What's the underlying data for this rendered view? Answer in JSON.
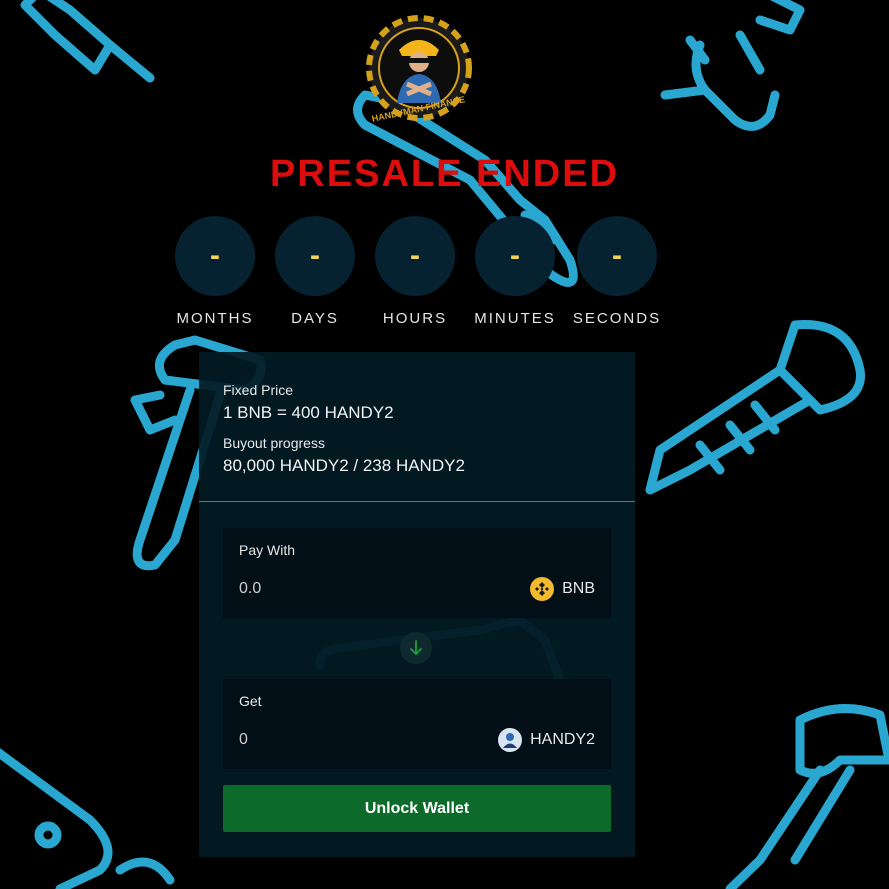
{
  "logo": {
    "text": "HANDYMAN FINANCE"
  },
  "status_title": "PRESALE ENDED",
  "countdown": [
    {
      "value": "-",
      "label": "MONTHS"
    },
    {
      "value": "-",
      "label": "DAYS"
    },
    {
      "value": "-",
      "label": "HOURS"
    },
    {
      "value": "-",
      "label": "MINUTES"
    },
    {
      "value": "-",
      "label": "SECONDS"
    }
  ],
  "presale": {
    "fixed_price_label": "Fixed Price",
    "fixed_price_value": "1 BNB = 400 HANDY2",
    "progress_label": "Buyout progress",
    "progress_value": "80,000 HANDY2 / 238 HANDY2"
  },
  "pay": {
    "label": "Pay With",
    "value": "0.0",
    "token": "BNB",
    "token_icon": "bnb-icon"
  },
  "get": {
    "label": "Get",
    "value": "0",
    "token": "HANDY2",
    "token_icon": "handy2-icon"
  },
  "swap_icon": "arrow-down-icon",
  "unlock_label": "Unlock Wallet",
  "colors": {
    "title": "#dd0d0d",
    "countdown_dash": "#f0d35b",
    "button": "#0c6a2a",
    "tools": "#2aa7d0",
    "bnb": "#f3ba2f"
  }
}
